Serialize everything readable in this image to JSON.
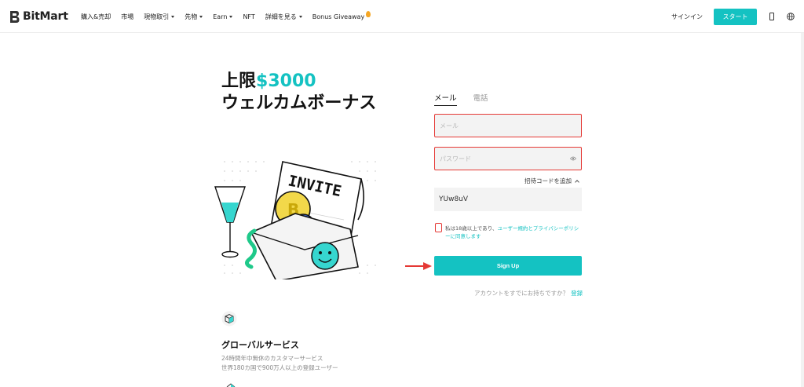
{
  "brand": {
    "name": "BitMart",
    "accent": "#14c2c2",
    "error": "#e53935"
  },
  "nav": {
    "items": [
      {
        "label": "購入&売却",
        "caret": false
      },
      {
        "label": "市場",
        "caret": false
      },
      {
        "label": "現物取引",
        "caret": true
      },
      {
        "label": "先物",
        "caret": true
      },
      {
        "label": "Earn",
        "caret": true
      },
      {
        "label": "NFT",
        "caret": false
      },
      {
        "label": "詳細を見る",
        "caret": true
      },
      {
        "label": "Bonus Giveaway",
        "caret": false
      }
    ],
    "signin": "サインイン",
    "start": "スタート",
    "icons": [
      "phone-icon",
      "globe-icon"
    ]
  },
  "hero": {
    "line1_prefix": "上限",
    "line1_accent": "$3000",
    "line2": "ウェルカムボーナス",
    "illustration_text": "INVITE"
  },
  "form": {
    "tabs": [
      "メール",
      "電話"
    ],
    "email_placeholder": "メール",
    "password_placeholder": "パスワード",
    "invite_toggle": "招待コードを追加",
    "invite_code": "YUw8uV",
    "terms_prefix": "私は18歳以上であり、",
    "terms_link": "ユーザー規約とプライバシーポリシー",
    "terms_suffix": "に同意します",
    "submit": "Sign Up",
    "login_prompt": "アカウントをすでにお持ちですか？",
    "login_link": "登録"
  },
  "feature": {
    "title": "グローバルサービス",
    "line1": "24時間年中無休のカスタマーサービス",
    "line2": "世界180カ国で900万人以上の登録ユーザー"
  }
}
